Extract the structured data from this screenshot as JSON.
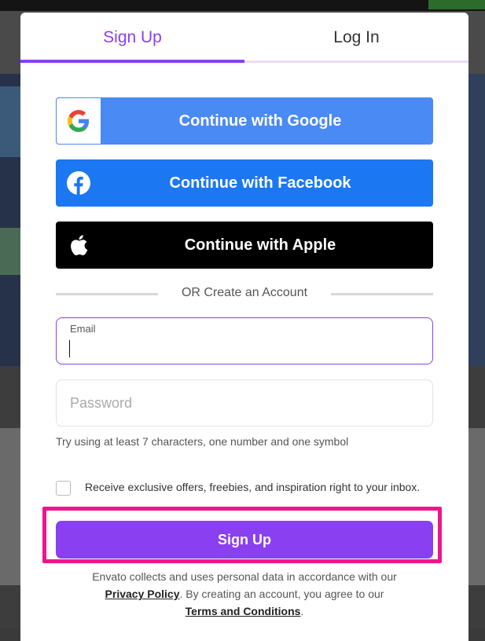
{
  "tabs": {
    "signup": "Sign Up",
    "login": "Log In"
  },
  "sso": {
    "google": "Continue with Google",
    "facebook": "Continue with Facebook",
    "apple": "Continue with Apple"
  },
  "divider": "OR Create an Account",
  "email": {
    "label": "Email",
    "value": ""
  },
  "password": {
    "placeholder": "Password"
  },
  "hint": "Try using at least 7 characters, one number and one symbol",
  "offers_checkbox": {
    "label": "Receive exclusive offers, freebies, and inspiration right to your inbox.",
    "checked": false
  },
  "signup_button": "Sign Up",
  "legal": {
    "line1": "Envato collects and uses personal data in accordance with our",
    "privacy": "Privacy Policy",
    "line2": ". By creating an account, you agree to our",
    "terms": "Terms and Conditions",
    "end": "."
  },
  "colors": {
    "accent": "#8a3ff0",
    "highlight": "#f0158a",
    "google": "#4a8af4",
    "facebook": "#1b77f2",
    "apple": "#000000"
  }
}
